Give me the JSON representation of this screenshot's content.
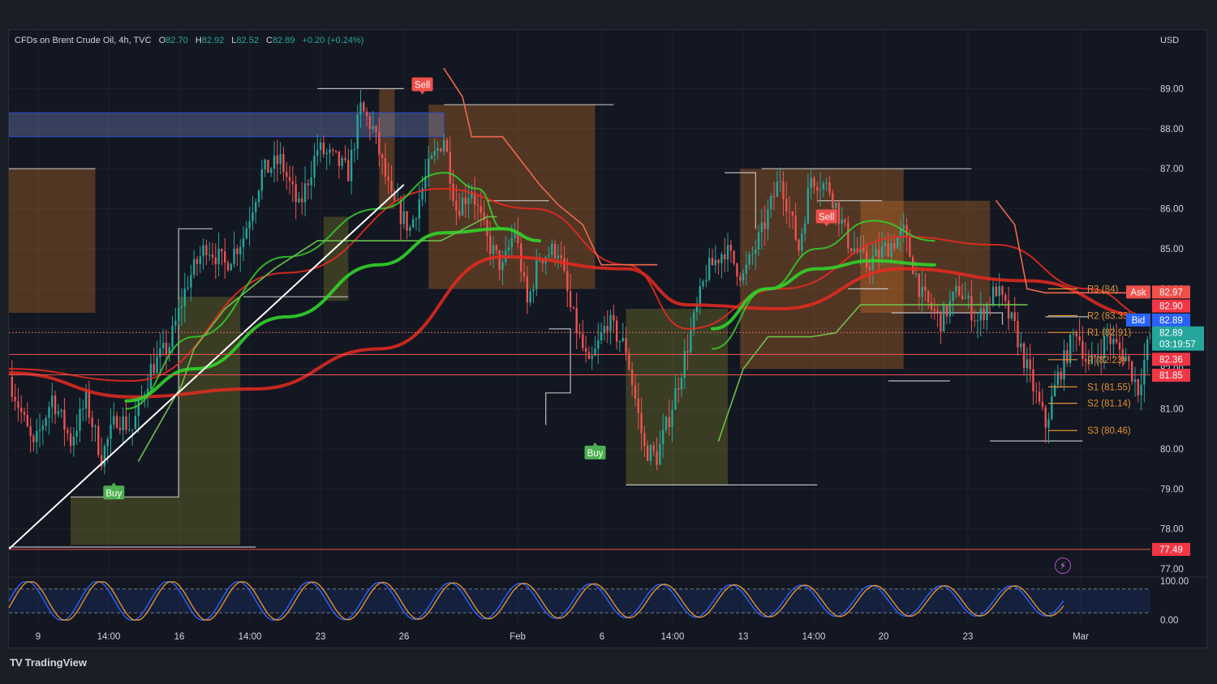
{
  "header": {
    "symbol": "CFDs on Brent Crude Oil, 4h, TVC",
    "o_label": "O",
    "o_value": "82.70",
    "h_label": "H",
    "h_value": "82.92",
    "l_label": "L",
    "l_value": "82.52",
    "c_label": "C",
    "c_value": "82.89",
    "change": "+0.20 (+0.24%)"
  },
  "currency": "USD",
  "brand": "TradingView",
  "colors": {
    "up": "#26a69a",
    "down": "#ef5350",
    "bg": "#131722",
    "grid": "#1e222d",
    "ema_red": "#e62a1f",
    "ema_green": "#32d22a",
    "signal_sell": "#f0504a",
    "signal_buy": "#4caf50",
    "pivot": "#e0922e",
    "stoch_k": "#2962ff",
    "stoch_d": "#e0922e",
    "ask": "#f0504a",
    "bid": "#2962ff"
  },
  "chart_data": {
    "type": "candlestick",
    "title": "CFDs on Brent Crude Oil, 4h, TVC",
    "ylabel": "USD",
    "ylim": [
      76.8,
      90.0
    ],
    "y_ticks": [
      "77.00",
      "78.00",
      "79.00",
      "80.00",
      "81.00",
      "82.00",
      "83.00",
      "84.00",
      "85.00",
      "86.00",
      "87.00",
      "88.00",
      "89.00"
    ],
    "x_ticks": [
      "9",
      "14:00",
      "16",
      "14:00",
      "23",
      "26",
      "Feb",
      "6",
      "14:00",
      "13",
      "14:00",
      "20",
      "23",
      "Mar"
    ],
    "price_path": [
      [
        0,
        81.8
      ],
      [
        8,
        80.0
      ],
      [
        14,
        81.3
      ],
      [
        20,
        80.2
      ],
      [
        25,
        81.2
      ],
      [
        30,
        79.8
      ],
      [
        35,
        80.8
      ],
      [
        40,
        80.5
      ],
      [
        46,
        82.0
      ],
      [
        52,
        82.6
      ],
      [
        58,
        84.2
      ],
      [
        64,
        85.1
      ],
      [
        70,
        84.6
      ],
      [
        76,
        85.3
      ],
      [
        82,
        86.9
      ],
      [
        88,
        87.2
      ],
      [
        94,
        86.0
      ],
      [
        100,
        87.5
      ],
      [
        106,
        87.2
      ],
      [
        110,
        86.9
      ],
      [
        114,
        88.5
      ],
      [
        118,
        88.0
      ],
      [
        124,
        86.2
      ],
      [
        130,
        85.5
      ],
      [
        136,
        87.0
      ],
      [
        141,
        87.8
      ],
      [
        145,
        86.0
      ],
      [
        150,
        86.5
      ],
      [
        155,
        85.2
      ],
      [
        160,
        84.5
      ],
      [
        164,
        85.5
      ],
      [
        168,
        83.6
      ],
      [
        172,
        84.8
      ],
      [
        178,
        85.0
      ],
      [
        182,
        83.5
      ],
      [
        188,
        82.0
      ],
      [
        194,
        83.2
      ],
      [
        200,
        82.5
      ],
      [
        206,
        80.0
      ],
      [
        210,
        79.8
      ],
      [
        214,
        80.8
      ],
      [
        220,
        82.6
      ],
      [
        226,
        84.4
      ],
      [
        232,
        85.0
      ],
      [
        238,
        84.3
      ],
      [
        244,
        85.4
      ],
      [
        250,
        86.8
      ],
      [
        256,
        85.0
      ],
      [
        260,
        86.8
      ],
      [
        266,
        86.5
      ],
      [
        272,
        85.2
      ],
      [
        278,
        84.6
      ],
      [
        284,
        85.0
      ],
      [
        290,
        85.4
      ],
      [
        296,
        83.8
      ],
      [
        302,
        83.2
      ],
      [
        308,
        84.0
      ],
      [
        314,
        83.2
      ],
      [
        320,
        84.0
      ],
      [
        326,
        83.0
      ],
      [
        330,
        82.0
      ],
      [
        336,
        80.6
      ],
      [
        340,
        81.8
      ],
      [
        346,
        83.0
      ],
      [
        350,
        82.0
      ],
      [
        356,
        82.8
      ],
      [
        362,
        82.3
      ],
      [
        366,
        81.5
      ],
      [
        370,
        82.89
      ]
    ],
    "series": [
      {
        "name": "EMA fast",
        "kind": "ema_red",
        "values": [
          [
            0,
            82.0
          ],
          [
            40,
            81.7
          ],
          [
            90,
            84.4
          ],
          [
            140,
            86.5
          ],
          [
            170,
            86.0
          ],
          [
            200,
            84.6
          ],
          [
            220,
            83.0
          ],
          [
            250,
            84.0
          ],
          [
            290,
            85.3
          ],
          [
            320,
            85.1
          ],
          [
            350,
            84.0
          ],
          [
            370,
            83.3
          ]
        ]
      },
      {
        "name": "EMA slow",
        "kind": "ema_red_wide",
        "values": [
          [
            0,
            81.9
          ],
          [
            40,
            81.3
          ],
          [
            80,
            81.5
          ],
          [
            120,
            82.5
          ],
          [
            160,
            84.8
          ],
          [
            200,
            84.5
          ],
          [
            220,
            83.6
          ],
          [
            250,
            83.5
          ],
          [
            290,
            84.5
          ],
          [
            330,
            84.2
          ],
          [
            370,
            83.3
          ]
        ]
      },
      {
        "name": "EMA green 1",
        "kind": "ema_green",
        "values": [
          [
            38,
            81.0
          ],
          [
            60,
            82.8
          ],
          [
            90,
            84.8
          ],
          [
            120,
            86.0
          ],
          [
            141,
            86.9
          ],
          [
            152,
            86.5
          ],
          [
            160,
            85.5
          ]
        ]
      },
      {
        "name": "EMA green 2",
        "kind": "ema_green_wide",
        "values": [
          [
            38,
            81.2
          ],
          [
            60,
            82.0
          ],
          [
            90,
            83.3
          ],
          [
            120,
            84.6
          ],
          [
            141,
            85.4
          ],
          [
            160,
            85.5
          ],
          [
            172,
            85.2
          ]
        ]
      },
      {
        "name": "EMA green 3",
        "kind": "ema_green",
        "values": [
          [
            228,
            82.5
          ],
          [
            246,
            84.0
          ],
          [
            262,
            85.0
          ],
          [
            280,
            85.7
          ],
          [
            300,
            85.2
          ]
        ]
      },
      {
        "name": "EMA green 4",
        "kind": "ema_green_wide",
        "values": [
          [
            228,
            83.0
          ],
          [
            246,
            84.0
          ],
          [
            262,
            84.5
          ],
          [
            280,
            84.7
          ],
          [
            300,
            84.6
          ]
        ]
      },
      {
        "name": "Trailing stop sell",
        "kind": "trail_sell",
        "values": [
          [
            141,
            89.5
          ],
          [
            147,
            88.8
          ],
          [
            150,
            87.8
          ],
          [
            160,
            87.8
          ],
          [
            172,
            86.6
          ],
          [
            178,
            86.1
          ],
          [
            186,
            85.6
          ],
          [
            192,
            84.6
          ],
          [
            210,
            84.6
          ]
        ]
      },
      {
        "name": "Trailing stop sell 2",
        "kind": "trail_sell",
        "values": [
          [
            320,
            86.2
          ],
          [
            326,
            85.6
          ],
          [
            330,
            84.0
          ],
          [
            336,
            83.9
          ],
          [
            365,
            83.9
          ]
        ]
      },
      {
        "name": "Trailing stop buy",
        "kind": "trail_buy",
        "values": [
          [
            42,
            79.7
          ],
          [
            56,
            81.6
          ],
          [
            60,
            82.5
          ],
          [
            70,
            83.5
          ],
          [
            86,
            84.5
          ],
          [
            100,
            85.2
          ],
          [
            140,
            85.2
          ],
          [
            155,
            85.8
          ],
          [
            158,
            85.8
          ]
        ]
      },
      {
        "name": "Trailing stop buy 2",
        "kind": "trail_buy",
        "values": [
          [
            230,
            80.2
          ],
          [
            238,
            82.0
          ],
          [
            246,
            82.8
          ],
          [
            260,
            82.8
          ],
          [
            268,
            82.9
          ],
          [
            276,
            83.6
          ],
          [
            300,
            83.6
          ],
          [
            330,
            83.6
          ]
        ]
      }
    ],
    "zones": [
      {
        "kind": "supply",
        "x0": 0,
        "x1": 28,
        "y0": 83.4,
        "y1": 87.0
      },
      {
        "kind": "demand",
        "x0": 20,
        "x1": 75,
        "y0": 77.6,
        "y1": 78.8
      },
      {
        "kind": "demand",
        "x0": 55,
        "x1": 75,
        "y0": 78.8,
        "y1": 83.8
      },
      {
        "kind": "supply",
        "x0": 120,
        "x1": 125,
        "y0": 86.0,
        "y1": 89.0
      },
      {
        "kind": "demand",
        "x0": 102,
        "x1": 110,
        "y0": 83.7,
        "y1": 85.8
      },
      {
        "kind": "supply",
        "x0": 136,
        "x1": 190,
        "y0": 84.0,
        "y1": 88.6
      },
      {
        "kind": "demand",
        "x0": 200,
        "x1": 233,
        "y0": 79.1,
        "y1": 83.5
      },
      {
        "kind": "supply",
        "x0": 237,
        "x1": 290,
        "y0": 82.0,
        "y1": 87.0
      },
      {
        "kind": "supply",
        "x0": 276,
        "x1": 318,
        "y0": 83.4,
        "y1": 86.2
      },
      {
        "kind": "band",
        "x0": 0,
        "x1": 141,
        "y0": 87.8,
        "y1": 88.4
      }
    ],
    "trendline": [
      [
        0,
        77.5
      ],
      [
        128,
        86.6
      ]
    ],
    "h_lines": [
      {
        "y": 82.91,
        "style": "dotted",
        "color": "#e06a60"
      },
      {
        "y": 82.36,
        "style": "solid",
        "color": "#ef5350"
      },
      {
        "y": 81.85,
        "style": "solid",
        "color": "#ef5350"
      },
      {
        "y": 77.49,
        "style": "solid",
        "color": "#ef5350"
      }
    ],
    "signals": [
      {
        "type": "sell",
        "label": "Sell",
        "x": 134,
        "y": 89.1
      },
      {
        "type": "sell",
        "label": "Sell",
        "x": 265,
        "y": 85.8
      },
      {
        "type": "buy",
        "label": "Buy",
        "x": 34,
        "y": 78.9
      },
      {
        "type": "buy",
        "label": "Buy",
        "x": 190,
        "y": 79.9
      }
    ],
    "pivots": [
      {
        "label": "R3 (84)",
        "y": 84.0
      },
      {
        "label": "R2 (83.33)",
        "y": 83.33
      },
      {
        "label": "R1 (82.91)",
        "y": 82.91
      },
      {
        "label": "P (82.23)",
        "y": 82.23
      },
      {
        "label": "S1 (81.55)",
        "y": 81.55
      },
      {
        "label": "S2 (81.14)",
        "y": 81.14
      },
      {
        "label": "S3 (80.46)",
        "y": 80.46
      }
    ],
    "price_tags": [
      {
        "label": "Ask",
        "value": "82.97",
        "y": 83.92,
        "kind": "ask"
      },
      {
        "label": "",
        "value": "82.90",
        "y": 83.57,
        "kind": "down"
      },
      {
        "label": "Bid",
        "value": "82.89",
        "y": 83.22,
        "kind": "bid"
      },
      {
        "label": "",
        "value": "82.89",
        "y": 82.9,
        "kind": "up",
        "countdown": "03:19:57"
      },
      {
        "label": "",
        "value": "82.36",
        "y": 82.24,
        "kind": "down"
      },
      {
        "label": "",
        "value": "81.85",
        "y": 81.84,
        "kind": "down"
      },
      {
        "label": "",
        "value": "77.49",
        "y": 77.49,
        "kind": "down"
      }
    ],
    "oscillator": {
      "name": "Stochastic",
      "ylim": [
        0,
        100
      ],
      "ticks": [
        "100.00",
        "0.00"
      ],
      "overbought": 80,
      "oversold": 20,
      "cycles": 15
    }
  }
}
